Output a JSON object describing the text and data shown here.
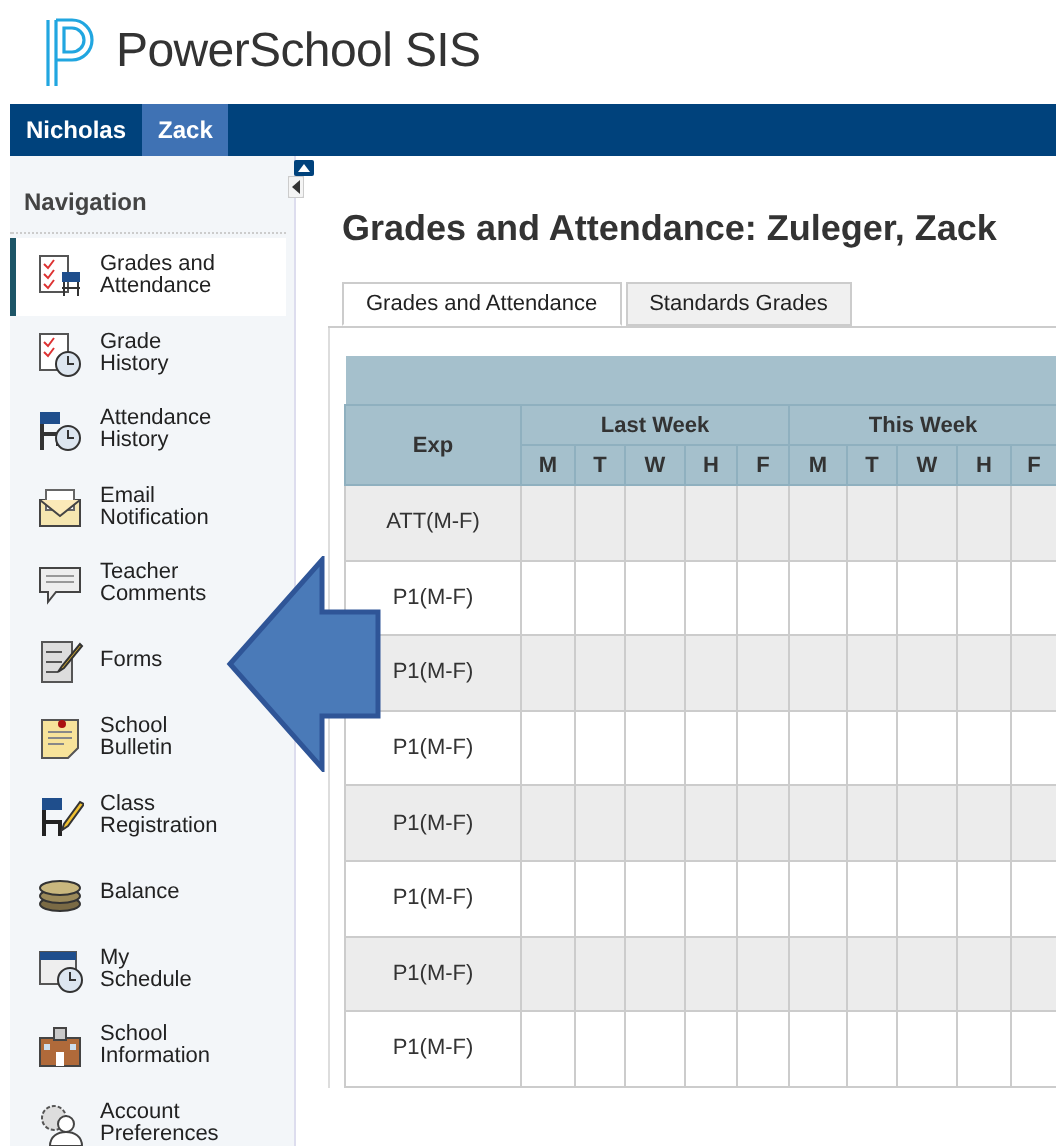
{
  "brand": {
    "name": "PowerSchool SIS"
  },
  "students": [
    {
      "label": "Nicholas",
      "selected": false
    },
    {
      "label": "Zack",
      "selected": true
    }
  ],
  "sidebar": {
    "title": "Navigation",
    "items": [
      {
        "label": "Grades and Attendance",
        "selected": true
      },
      {
        "label": "Grade History",
        "selected": false
      },
      {
        "label": "Attendance History",
        "selected": false
      },
      {
        "label": "Email Notification",
        "selected": false
      },
      {
        "label": "Teacher Comments",
        "selected": false
      },
      {
        "label": "Forms",
        "selected": false
      },
      {
        "label": "School Bulletin",
        "selected": false
      },
      {
        "label": "Class Registration",
        "selected": false
      },
      {
        "label": "Balance",
        "selected": false
      },
      {
        "label": "My Schedule",
        "selected": false
      },
      {
        "label": "School Information",
        "selected": false
      },
      {
        "label": "Account Preferences",
        "selected": false
      }
    ]
  },
  "page": {
    "title": "Grades and Attendance: Zuleger, Zack",
    "tabs": [
      {
        "label": "Grades and Attendance",
        "selected": true
      },
      {
        "label": "Standards Grades",
        "selected": false
      }
    ],
    "table": {
      "first_column": "Exp",
      "weeks": [
        {
          "label": "Last Week",
          "days": [
            "M",
            "T",
            "W",
            "H",
            "F"
          ]
        },
        {
          "label": "This Week",
          "days": [
            "M",
            "T",
            "W",
            "H",
            "F"
          ]
        }
      ],
      "rows": [
        {
          "exp": "ATT(M-F)"
        },
        {
          "exp": "P1(M-F)"
        },
        {
          "exp": "P1(M-F)"
        },
        {
          "exp": "P1(M-F)"
        },
        {
          "exp": "P1(M-F)"
        },
        {
          "exp": "P1(M-F)"
        },
        {
          "exp": "P1(M-F)"
        },
        {
          "exp": "P1(M-F)"
        }
      ]
    }
  }
}
